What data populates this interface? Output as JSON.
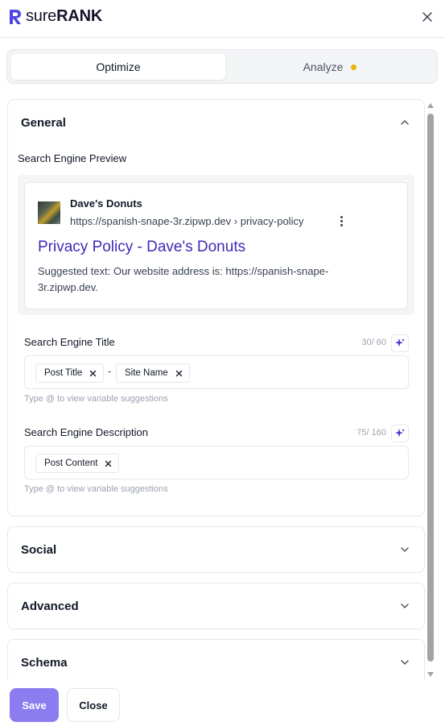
{
  "app": {
    "logo_text_light": "sure",
    "logo_text_bold": "RANK"
  },
  "tabs": [
    {
      "label": "Optimize",
      "active": true
    },
    {
      "label": "Analyze",
      "active": false,
      "status_color": "#eab308"
    }
  ],
  "sections": {
    "general": {
      "title": "General",
      "expanded": true,
      "preview_label": "Search Engine Preview",
      "preview": {
        "site_name": "Dave's Donuts",
        "url": "https://spanish-snape-3r.zipwp.dev › privacy-policy",
        "title": "Privacy Policy - Dave's Donuts",
        "description": "Suggested text: Our website address is: https://spanish-snape-3r.zipwp.dev."
      },
      "title_field": {
        "label": "Search Engine Title",
        "counter": "30/ 60",
        "chips": [
          "Post Title",
          "Site Name"
        ],
        "separator": "-",
        "hint": "Type @ to view variable suggestions"
      },
      "description_field": {
        "label": "Search Engine Description",
        "counter": "75/ 160",
        "chips": [
          "Post Content"
        ],
        "hint": "Type @ to view variable suggestions"
      }
    },
    "social": {
      "title": "Social",
      "expanded": false
    },
    "advanced": {
      "title": "Advanced",
      "expanded": false
    },
    "schema": {
      "title": "Schema",
      "expanded": false
    }
  },
  "footer": {
    "save_label": "Save",
    "close_label": "Close"
  },
  "colors": {
    "brand": "#4f46e5",
    "link": "#3b2bb5",
    "save_button": "#8b7cf0",
    "ai_icon": "#4338ca"
  }
}
